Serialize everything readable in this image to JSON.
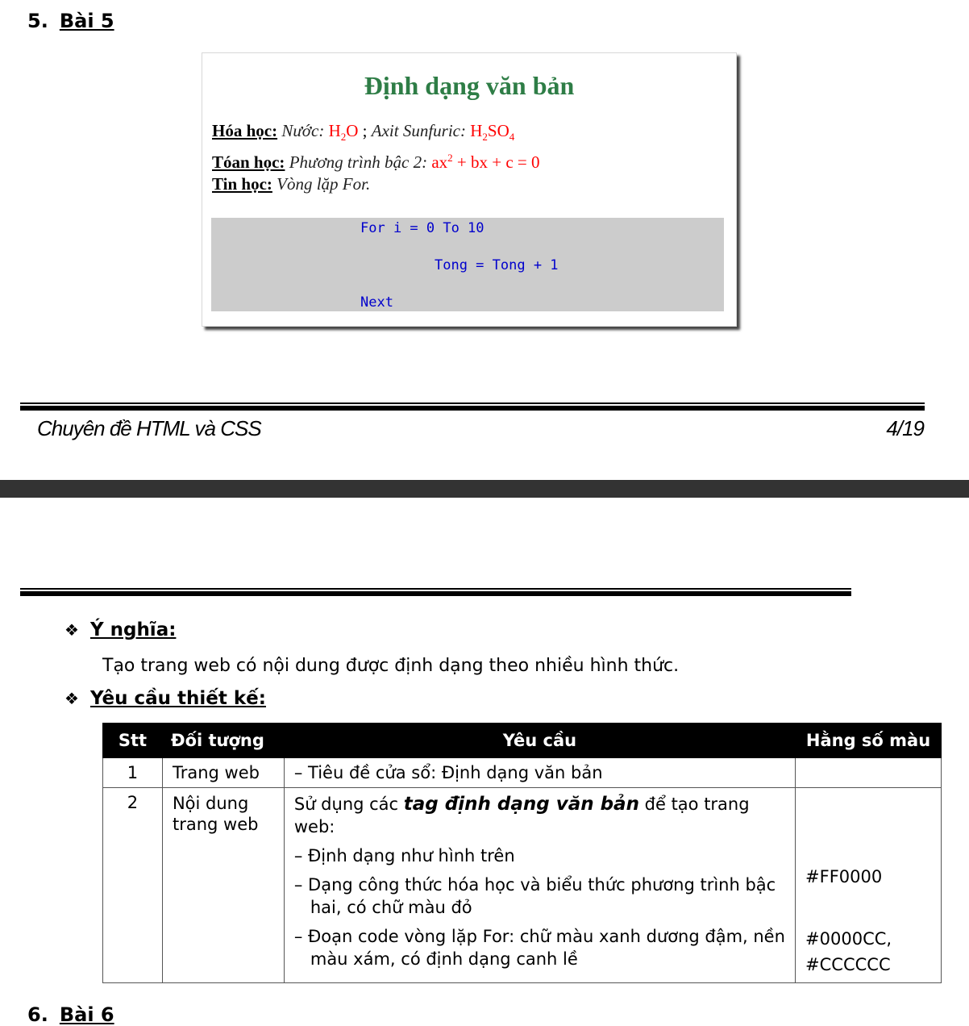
{
  "section": {
    "number": "5.",
    "title": "Bài 5"
  },
  "preview": {
    "heading": "Định dạng văn bản",
    "chem_label": "Hóa học:",
    "chem_water_label": "Nước:",
    "chem_water_h": "H",
    "chem_water_sub": "2",
    "chem_water_o": "O",
    "chem_sep": ";",
    "chem_acid_label": "Axit Sunfuric:",
    "chem_acid_h": "H",
    "chem_acid_sub1": "2",
    "chem_acid_so": "SO",
    "chem_acid_sub2": "4",
    "math_label": "Tóan học:",
    "math_text": "Phương trình bậc 2:",
    "math_ax": "ax",
    "math_sup": "2",
    "math_rest": "+ bx + c = 0",
    "it_label": "Tin học:",
    "it_text": "Vòng lặp For.",
    "code": [
      "For i = 0 To 10",
      "Tong = Tong + 1",
      "Next"
    ]
  },
  "footer": {
    "left": "Chuyên đề HTML và CSS",
    "right": "4/19"
  },
  "meaning": {
    "label": "Ý nghĩa:",
    "text": "Tạo trang web có nội dung được định dạng theo nhiều hình thức."
  },
  "design": {
    "label": "Yêu cầu thiết kế:"
  },
  "table": {
    "headers": [
      "Stt",
      "Đối tượng",
      "Yêu cầu",
      "Hằng số màu"
    ],
    "row1": {
      "stt": "1",
      "object": "Trang web",
      "req": "– Tiêu đề cửa sổ: Định dạng văn bản",
      "color": ""
    },
    "row2": {
      "stt": "2",
      "object": "Nội dung trang web",
      "req_intro_a": "Sử dụng các",
      "req_intro_b": "tag định dạng văn bản",
      "req_intro_c": "để tạo trang web:",
      "req_item1": "– Định dạng như hình trên",
      "req_item2": "– Dạng công thức hóa học và biểu thức phương trình bậc hai, có chữ màu đỏ",
      "req_item3": "– Đoạn code vòng lặp For: chữ màu xanh dương đậm, nền màu xám, có định dạng canh lề",
      "color2": "#FF0000",
      "color3a": "#0000CC,",
      "color3b": "#CCCCCC"
    }
  },
  "next_section": {
    "number": "6.",
    "title": "Bài 6"
  }
}
